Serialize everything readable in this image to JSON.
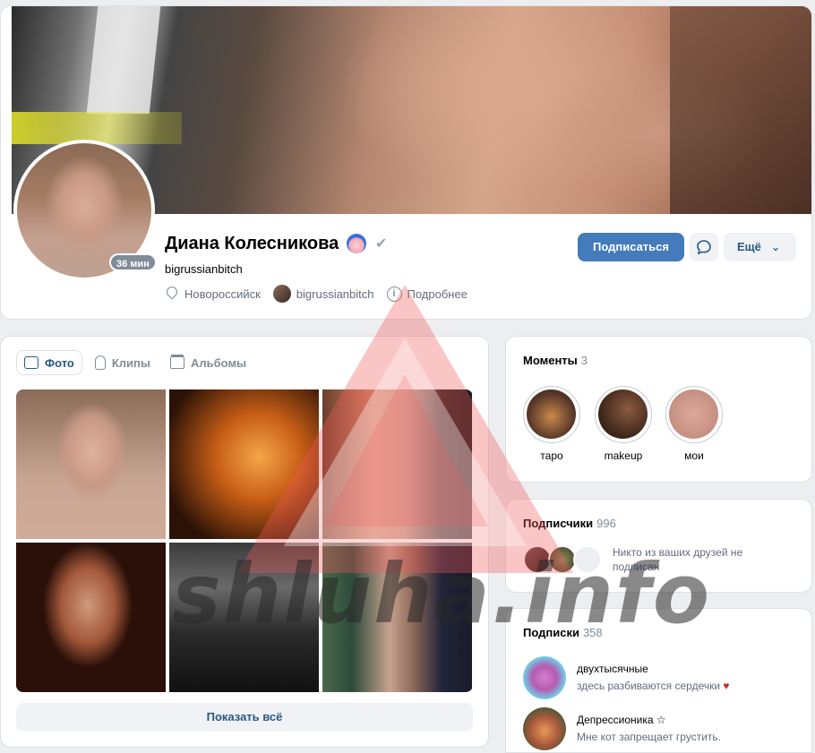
{
  "profile": {
    "name": "Диана Колесникова",
    "screen_name": "bigrussianbitch",
    "online_badge": "36 мин",
    "location": "Новороссийск",
    "link_name": "bigrussianbitch",
    "details_label": "Подробнее",
    "subscribe_label": "Подписаться",
    "more_label": "Ещё"
  },
  "photos": {
    "tabs": [
      {
        "label": "Фото",
        "icon": "image-icon"
      },
      {
        "label": "Клипы",
        "icon": "clip-icon"
      },
      {
        "label": "Альбомы",
        "icon": "album-icon"
      }
    ],
    "show_all_label": "Показать всё"
  },
  "moments": {
    "title": "Моменты",
    "count": "3",
    "items": [
      {
        "label": "таро"
      },
      {
        "label": "makeup"
      },
      {
        "label": "мои"
      }
    ]
  },
  "subscribers": {
    "title": "Подписчики",
    "count": "996",
    "note": "Никто из ваших друзей не подписан"
  },
  "follows": {
    "title": "Подписки",
    "count": "358",
    "items": [
      {
        "name": "двухтысячные",
        "status": "здесь разбиваются сердечки"
      },
      {
        "name": "Депрессионика ☆",
        "status": "Мне кот запрещает грустить."
      }
    ]
  },
  "watermark": {
    "text": "shluha.info"
  },
  "colors": {
    "accent": "#447bba",
    "link": "#2a5885",
    "page_bg": "#edeef0",
    "watermark_triangle": "#f25a5a"
  }
}
